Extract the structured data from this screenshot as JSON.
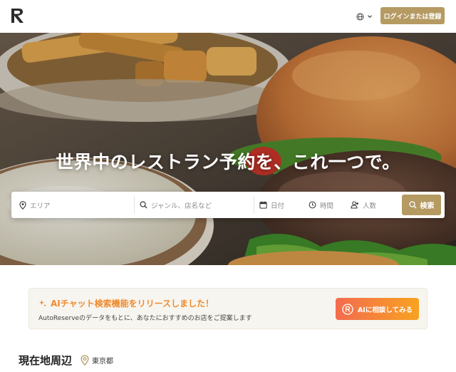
{
  "header": {
    "logo_alt": "AutoReserve",
    "language_icon": "globe-icon",
    "language_chevron": "chevron-down-icon",
    "login_label": "ログインまたは登録"
  },
  "hero": {
    "title": "世界中のレストラン予約を、これ一つで。",
    "search": {
      "area_placeholder": "エリア",
      "keyword_placeholder": "ジャンル、店名など",
      "date_label": "日付",
      "time_label": "時間",
      "people_label": "人数",
      "search_button_label": "検索"
    }
  },
  "ai_banner": {
    "title": "AIチャット検索機能をリリースしました！",
    "description": "AutoReserveのデータをもとに、あなたにおすすめのお店をご提案します",
    "button_label": "AIに相談してみる"
  },
  "nearby": {
    "title": "現在地周辺",
    "location": "東京都"
  },
  "colors": {
    "accent": "#b59a62",
    "banner_title": "#f08a2c",
    "ai_gradient_start": "#f36b4f",
    "ai_gradient_end": "#f8a221"
  }
}
